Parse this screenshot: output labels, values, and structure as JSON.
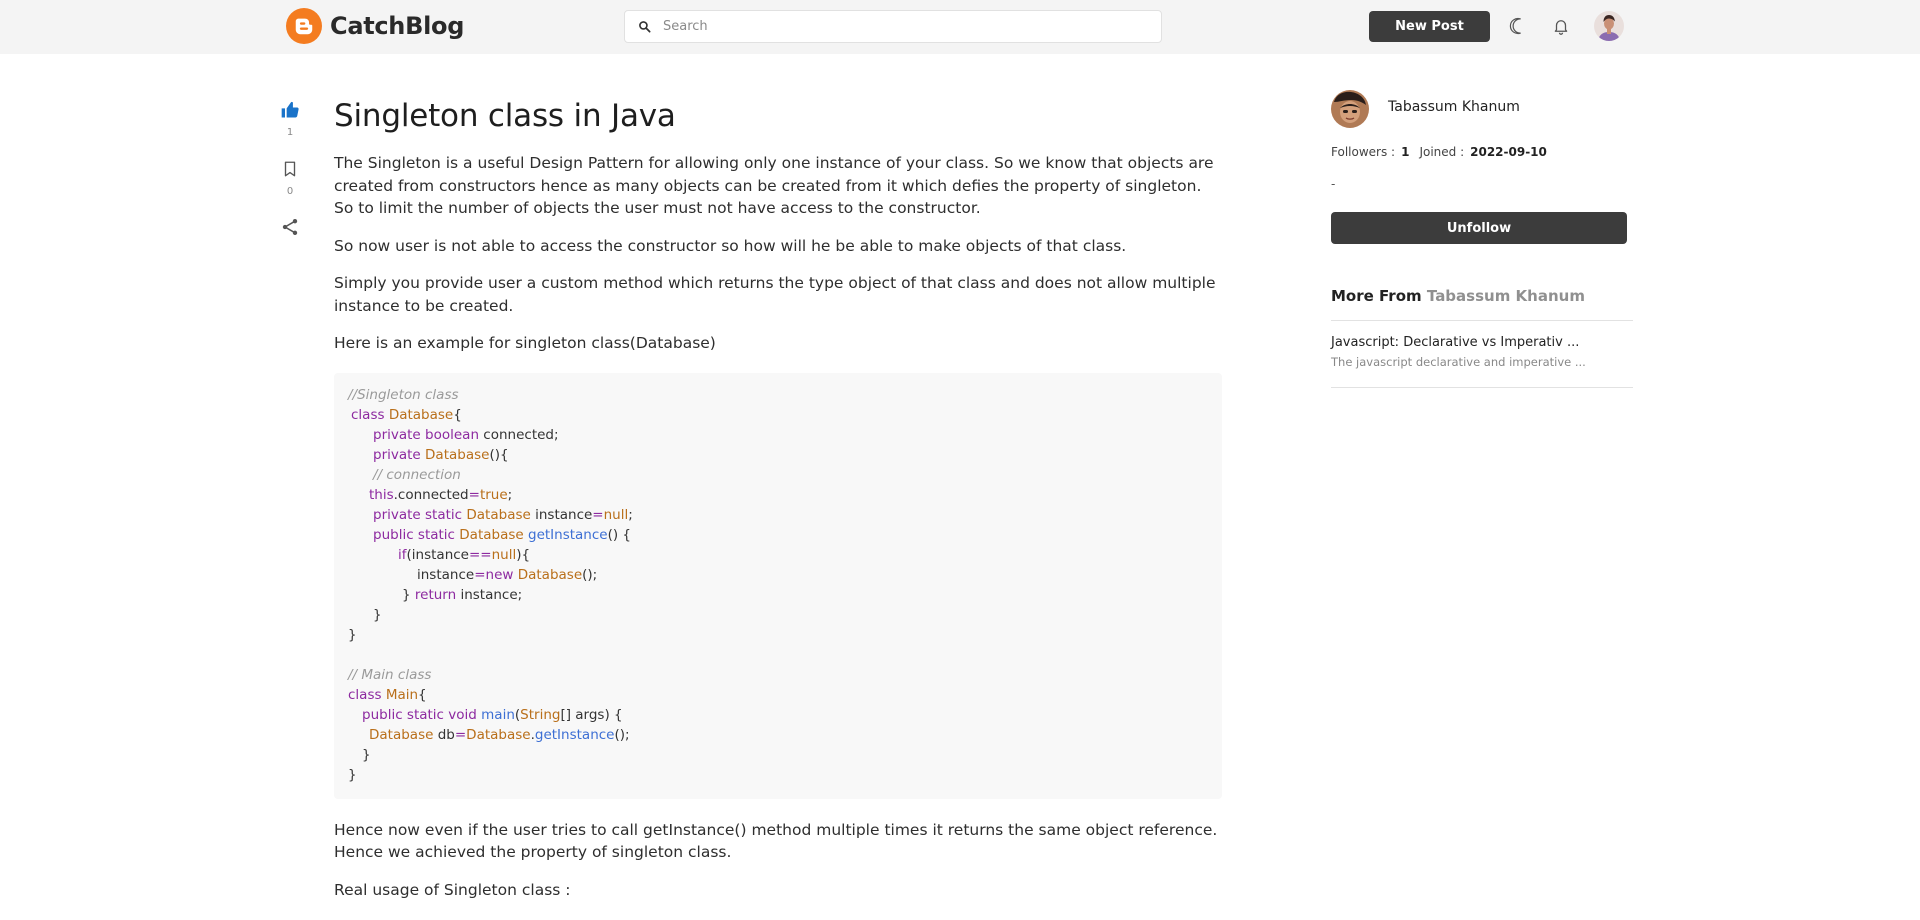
{
  "header": {
    "brand_name": "CatchBlog",
    "search_placeholder": "Search",
    "new_post_label": "New Post",
    "brand_color": "#f47c20",
    "icons": [
      "blogger-logo-icon",
      "search-icon",
      "moon-icon",
      "bell-icon",
      "user-avatar"
    ]
  },
  "actions": {
    "like_count": "1",
    "bookmark_count": "0",
    "like_color": "#1a73c9"
  },
  "article": {
    "title": "Singleton class in Java",
    "paragraphs_before": [
      "The Singleton is a useful Design Pattern for allowing only one instance of your class. So we know that objects are created from constructors hence as many objects can be created from it which defies the property of singleton. So to limit the number of objects the user must not have access to the constructor.",
      "So now user is not able to access the constructor so how will he be able to make objects of that class.",
      "Simply you provide user a custom method which returns the type object of that class and does not allow multiple instance to be created.",
      "Here is an example for singleton class(Database)"
    ],
    "code": {
      "l1": "//Singleton class",
      "l2_kw": "class",
      "l2_ty": "Database",
      "l2_p": "{",
      "l3_kw": "private boolean",
      "l3_p": " connected;",
      "l4_kw": "private",
      "l4_ty": "Database",
      "l4_p": "(){",
      "l5": "// connection",
      "l6_kw": "this",
      "l6_p": ".connected",
      "l6_op": "=",
      "l6_kw2": "true",
      "l6_p2": ";",
      "l7_kw": "private static",
      "l7_ty": "Database",
      "l7_p": " instance",
      "l7_op": "=",
      "l7_kw2": "null",
      "l7_p2": ";",
      "l8_kw": "public static",
      "l8_ty": "Database",
      "l8_fn": "getInstance",
      "l8_p": "() {",
      "l9_kw": "if",
      "l9_p": "(instance",
      "l9_op": "==",
      "l9_kw2": "null",
      "l9_p2": "){",
      "l10_p": "instance",
      "l10_op": "=",
      "l10_kw": "new",
      "l10_ty": "Database",
      "l10_p2": "();",
      "l11_p": "} ",
      "l11_kw": "return",
      "l11_p2": " instance;",
      "l12": "}",
      "l13": "}",
      "l14": "// Main class",
      "l15_kw": "class",
      "l15_ty": "Main",
      "l15_p": "{",
      "l16_kw": "public static void",
      "l16_fn": "main",
      "l16_p": "(",
      "l16_ty": "String",
      "l16_p2": "[] args) {",
      "l17_ty": "Database",
      "l17_p": " db",
      "l17_op": "=",
      "l17_ty2": "Database",
      "l17_p2": ".",
      "l17_fn": "getInstance",
      "l17_p3": "();",
      "l18": "}",
      "l19": "}"
    },
    "paragraphs_after": [
      "Hence now even if the user tries to call getInstance() method multiple times it returns the same object reference. Hence we achieved the property of singleton class.",
      "Real usage of Singleton class :"
    ]
  },
  "sidebar": {
    "author_name": "Tabassum Khanum",
    "followers_label": "Followers :",
    "followers_value": "1",
    "joined_label": "Joined :",
    "joined_value": "2022-09-10",
    "bio": "-",
    "unfollow_label": "Unfollow",
    "more_from_label": "More From",
    "more_from_author": "Tabassum Khanum",
    "more_items": [
      {
        "title": "Javascript: Declarative vs Imperativ ...",
        "desc": "The javascript declarative and imperative ..."
      }
    ]
  }
}
